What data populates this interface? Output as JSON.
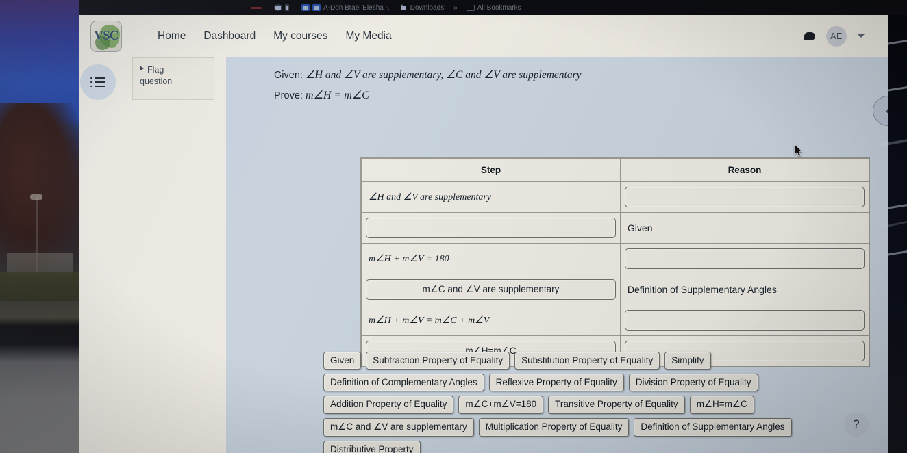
{
  "browser": {
    "bookmarks": [
      {
        "label": "",
        "icon": "tab-red-icon"
      },
      {
        "label": "",
        "icon": "bookmark-icon"
      },
      {
        "label": "A-Don Brael Elesha -.",
        "icon": "bookmark-icon"
      },
      {
        "label": "Downloads",
        "icon": "download-icon"
      },
      {
        "label": "»",
        "icon": "overflow-chevron-icon"
      },
      {
        "label": "All Bookmarks",
        "icon": "folder-icon"
      }
    ]
  },
  "navbar": {
    "logo_text": "VSC",
    "links": [
      {
        "label": "Home"
      },
      {
        "label": "Dashboard"
      },
      {
        "label": "My courses"
      },
      {
        "label": "My Media"
      }
    ],
    "messages_icon": "message-bubble-icon",
    "avatar_initials": "AE",
    "chevron_icon": "chevron-down-icon"
  },
  "quiz": {
    "nav_toggle_icon": "hamburger-list-icon",
    "flag": {
      "icon": "flag-icon",
      "line1": "Flag",
      "line2": "question"
    },
    "prompt": {
      "given_label": "Given:",
      "given_text": "∠H and ∠V are supplementary, ∠C and ∠V are supplementary",
      "prove_label": "Prove:",
      "prove_text": "m∠H = m∠C"
    },
    "table": {
      "headers": [
        "Step",
        "Reason"
      ],
      "rows": [
        {
          "step": "∠H and ∠V are supplementary",
          "step_slot": false,
          "reason": "",
          "reason_slot": true
        },
        {
          "step": "",
          "step_slot": true,
          "reason": "Given",
          "reason_slot": false
        },
        {
          "step": "m∠H + m∠V = 180",
          "step_slot": false,
          "reason": "",
          "reason_slot": true
        },
        {
          "step": "m∠C and ∠V are supplementary",
          "step_slot": true,
          "reason": "Definition of Supplementary Angles",
          "reason_slot": false
        },
        {
          "step": "m∠H + m∠V = m∠C + m∠V",
          "step_slot": false,
          "reason": "",
          "reason_slot": true
        },
        {
          "step": "m∠H=m∠C",
          "step_slot": true,
          "reason": "",
          "reason_slot": true
        }
      ]
    },
    "chips": [
      "Given",
      "Subtraction Property of Equality",
      "Substitution Property of Equality",
      "Simplify",
      "Definition of Complementary Angles",
      "Reflexive Property of Equality",
      "Division Property of Equality",
      "Addition Property of Equality",
      "m∠C+m∠V=180",
      "Transitive Property of Equality",
      "m∠H=m∠C",
      "m∠C and ∠V are supplementary",
      "Multiplication Property of Equality",
      "Definition of Supplementary Angles",
      "Distributive Property"
    ],
    "help_label": "?",
    "collapse_label": "‹"
  },
  "colors": {
    "page_bg": "#eceae3",
    "panel_bg": "#c8d3de",
    "table_bg": "#ebe9e1",
    "chip_bg": "#e4e2da",
    "nav_accent": "#ccd5e2"
  }
}
